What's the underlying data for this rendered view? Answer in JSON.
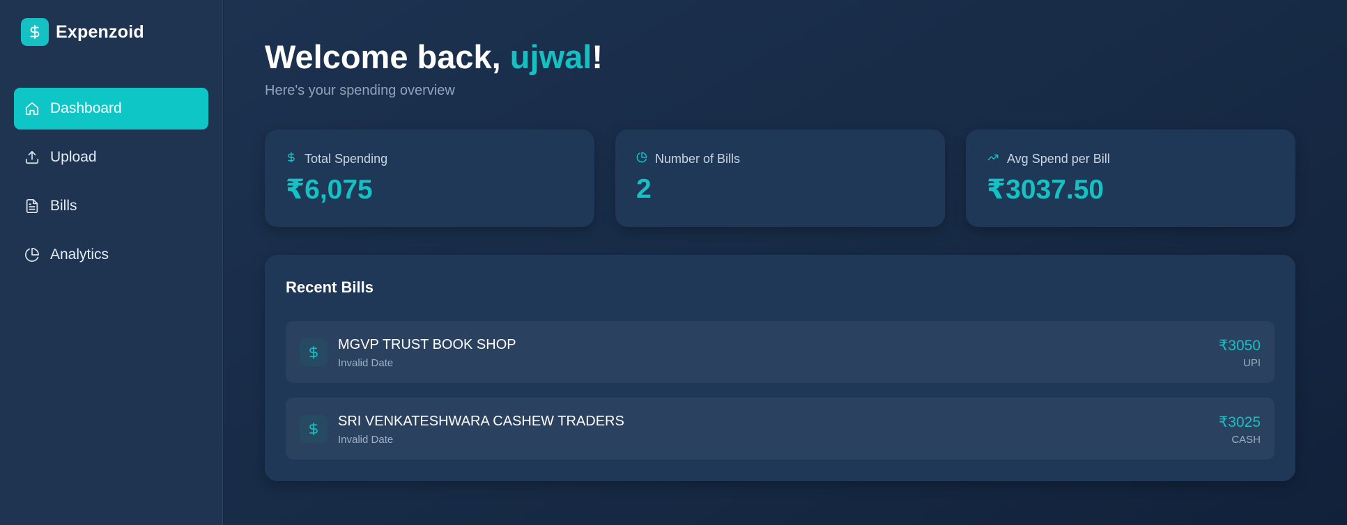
{
  "app": {
    "name": "Expenzoid",
    "logo_icon": "dollar-icon"
  },
  "colors": {
    "accent": "#14c0c2",
    "sidebar": "#1f3451",
    "card": "#203857",
    "bill_row": "#2a4260"
  },
  "sidebar": {
    "items": [
      {
        "label": "Dashboard",
        "icon": "home-icon",
        "active": true
      },
      {
        "label": "Upload",
        "icon": "upload-icon",
        "active": false
      },
      {
        "label": "Bills",
        "icon": "file-text-icon",
        "active": false
      },
      {
        "label": "Analytics",
        "icon": "pie-chart-icon",
        "active": false
      }
    ]
  },
  "header": {
    "greeting": "Welcome back, ",
    "user_name": "ujwal",
    "punctuation": "!",
    "subtitle": "Here's your spending overview"
  },
  "stats": [
    {
      "label": "Total Spending",
      "value": "₹6,075",
      "icon": "dollar-icon"
    },
    {
      "label": "Number of Bills",
      "value": "2",
      "icon": "pie-chart-icon"
    },
    {
      "label": "Avg Spend per Bill",
      "value": "₹3037.50",
      "icon": "trending-up-icon"
    }
  ],
  "recent_bills": {
    "title": "Recent Bills",
    "items": [
      {
        "name": "MGVP TRUST BOOK SHOP",
        "date": "Invalid Date",
        "amount": "₹3050",
        "method": "UPI",
        "icon": "dollar-icon"
      },
      {
        "name": "SRI VENKATESHWARA CASHEW TRADERS",
        "date": "Invalid Date",
        "amount": "₹3025",
        "method": "CASH",
        "icon": "dollar-icon"
      }
    ]
  }
}
